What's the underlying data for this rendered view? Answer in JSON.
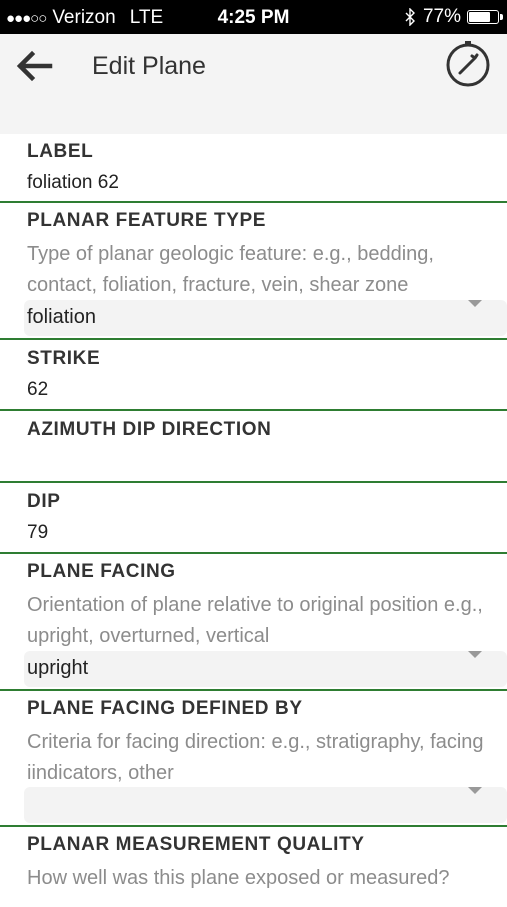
{
  "status_bar": {
    "signal": "●●●○○",
    "carrier": "Verizon",
    "network": "LTE",
    "time": "4:25 PM",
    "bluetooth": "bluetooth-icon",
    "battery_percent": "77%",
    "battery_level": 0.77
  },
  "header": {
    "title": "Edit Plane",
    "back_icon": "arrow-left-icon",
    "compass_icon": "compass-icon"
  },
  "fields": {
    "label": {
      "label": "LABEL",
      "value": "foliation 62"
    },
    "planar_feature_type": {
      "label": "PLANAR FEATURE TYPE",
      "help": "Type of planar geologic feature: e.g., bedding, contact, foliation, fracture, vein, shear zone",
      "value": "foliation"
    },
    "strike": {
      "label": "STRIKE",
      "value": "62"
    },
    "azimuth_dip_direction": {
      "label": "AZIMUTH DIP DIRECTION",
      "value": ""
    },
    "dip": {
      "label": "DIP",
      "value": "79"
    },
    "plane_facing": {
      "label": "PLANE FACING",
      "help": "Orientation of plane relative to original position e.g., upright, overturned, vertical",
      "value": "upright"
    },
    "plane_facing_defined_by": {
      "label": "PLANE FACING DEFINED BY",
      "help": "Criteria for facing direction: e.g., stratigraphy, facing iindicators, other",
      "value": ""
    },
    "planar_measurement_quality": {
      "label": "PLANAR MEASUREMENT QUALITY",
      "help": "How well was this plane exposed or measured?"
    }
  },
  "colors": {
    "divider": "#2e7d32",
    "app_bar_bg": "#f4f4f4",
    "select_bg": "#f3f3f3",
    "help_text": "#8c8c8c"
  }
}
